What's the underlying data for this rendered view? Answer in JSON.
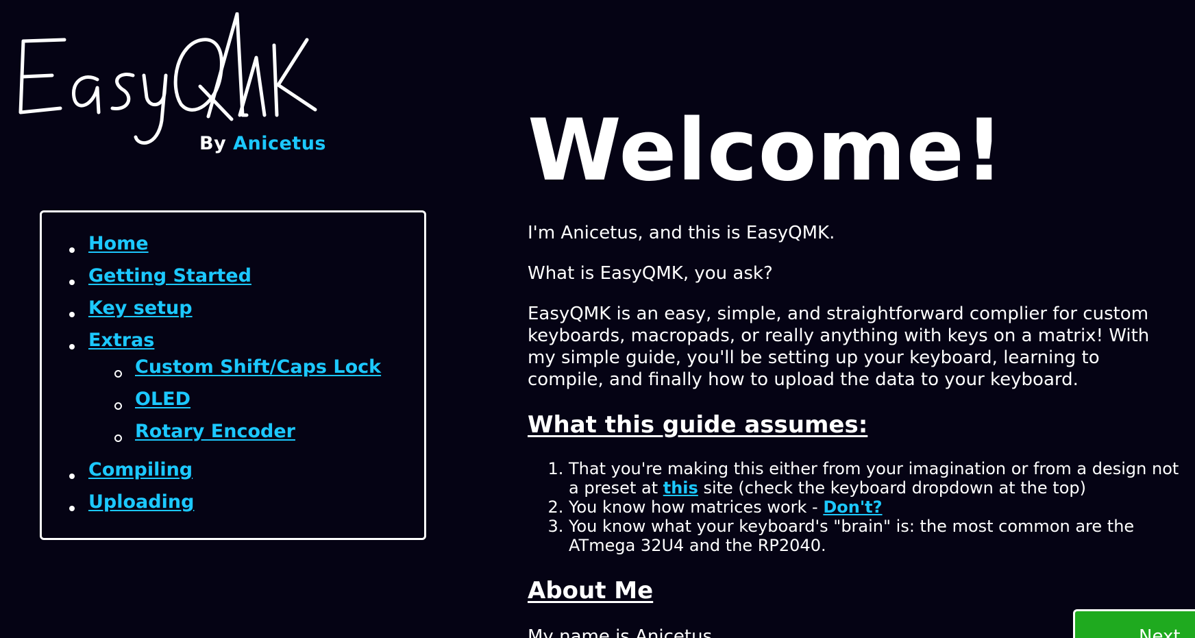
{
  "logo": {
    "wordmark": "EasyQMK",
    "by_label": "By",
    "author": "Anicetus"
  },
  "nav": {
    "items": [
      {
        "label": "Home"
      },
      {
        "label": "Getting Started"
      },
      {
        "label": "Key setup"
      },
      {
        "label": "Extras",
        "children": [
          {
            "label": "Custom Shift/Caps Lock"
          },
          {
            "label": "OLED"
          },
          {
            "label": "Rotary Encoder"
          }
        ]
      },
      {
        "label": "Compiling"
      },
      {
        "label": "Uploading"
      }
    ]
  },
  "main": {
    "heading": "Welcome!",
    "intro_1": "I'm Anicetus, and this is EasyQMK.",
    "intro_2": "What is EasyQMK, you ask?",
    "intro_3_line1": "EasyQMK is an easy, simple, and straightforward complier for custom",
    "intro_3_line2": "keyboards, macropads, or really anything with keys on a matrix! With",
    "intro_3_line3": "my simple guide, you'll be setting up your keyboard, learning to",
    "intro_3_line4": "compile, and finally how to upload the data to your keyboard.",
    "assumes_heading": "What this guide assumes:",
    "assumes": [
      {
        "line1": "That you're making this either from your imagination or from a design not",
        "pre": "a preset at ",
        "link": "this",
        "post": " site (check the keyboard dropdown at the top)"
      },
      {
        "pre": "You know how matrices work - ",
        "link": "Don't?"
      },
      {
        "line1": "You know what your keyboard's \"brain\" is: the most common are the",
        "line2": "ATmega 32U4 and the RP2040."
      }
    ],
    "about_heading": "About Me",
    "about_text": "My name is Anicetus"
  },
  "next_button": {
    "label": "Next"
  },
  "colors": {
    "background": "#050314",
    "link": "#1cc8ff",
    "next_button": "#1faa1f",
    "text": "#ffffff"
  }
}
